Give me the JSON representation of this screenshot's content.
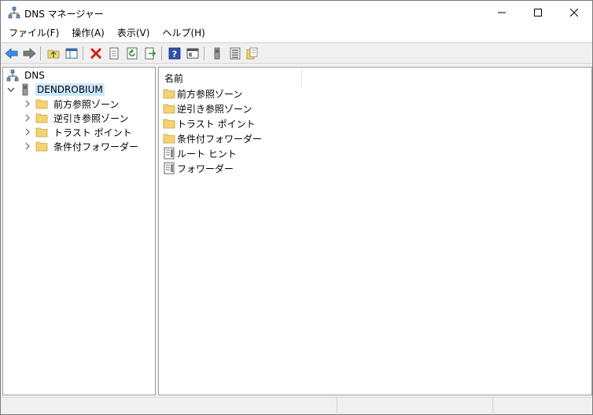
{
  "window": {
    "title": "DNS マネージャー"
  },
  "menu": [
    {
      "label": "ファイル(F)"
    },
    {
      "label": "操作(A)"
    },
    {
      "label": "表示(V)"
    },
    {
      "label": "ヘルプ(H)"
    }
  ],
  "toolbar": {
    "icons": [
      "back-icon",
      "forward-icon",
      "up-folder-icon",
      "show-hide-tree-icon",
      "delete-icon",
      "properties-icon",
      "refresh-icon",
      "export-list-icon",
      "help-icon",
      "view-icon",
      "server-icon",
      "list-icon",
      "copy-icon"
    ]
  },
  "tree": {
    "root": {
      "label": "DNS"
    },
    "server": {
      "label": "DENDROBIUM"
    },
    "children": [
      {
        "label": "前方参照ゾーン"
      },
      {
        "label": "逆引き参照ゾーン"
      },
      {
        "label": "トラスト ポイント"
      },
      {
        "label": "条件付フォワーダー"
      }
    ]
  },
  "list": {
    "header": "名前",
    "items": [
      {
        "label": "前方参照ゾーン",
        "icon": "folder-icon"
      },
      {
        "label": "逆引き参照ゾーン",
        "icon": "folder-icon"
      },
      {
        "label": "トラスト ポイント",
        "icon": "folder-icon"
      },
      {
        "label": "条件付フォワーダー",
        "icon": "folder-icon"
      },
      {
        "label": "ルート ヒント",
        "icon": "document-icon"
      },
      {
        "label": "フォワーダー",
        "icon": "document-icon"
      }
    ]
  },
  "colors": {
    "selection": "#cce8ff",
    "folder": "#f5d274",
    "accent": "#0078d7"
  }
}
